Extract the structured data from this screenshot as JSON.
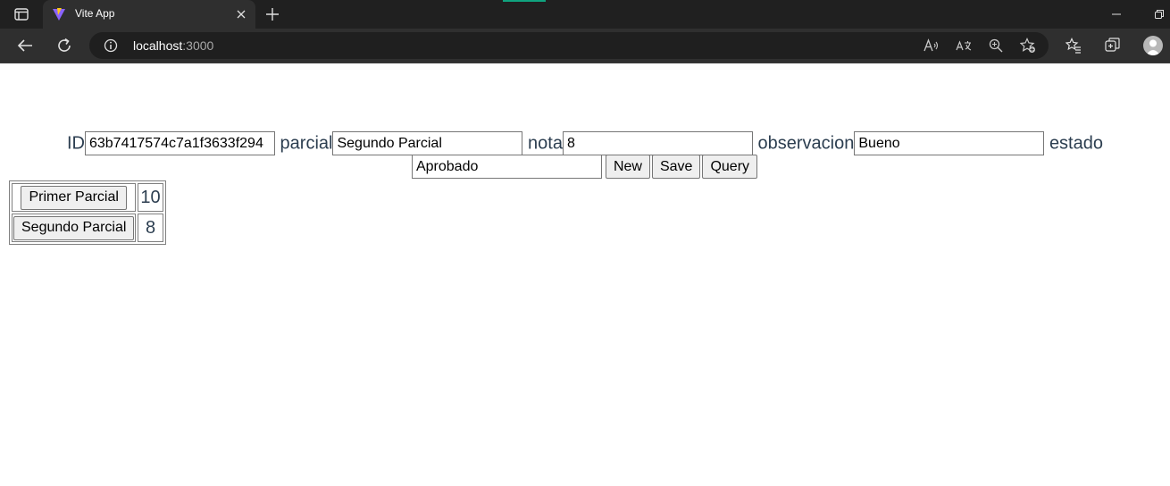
{
  "browser": {
    "tab_title": "Vite App",
    "url_host": "localhost",
    "url_port": ":3000",
    "icons": [
      "tab-actions-icon",
      "vite-favicon-icon",
      "close-icon",
      "plus-icon",
      "minimize-icon",
      "restore-icon",
      "back-arrow-icon",
      "refresh-icon",
      "info-icon",
      "read-aloud-icon",
      "translate-icon",
      "zoom-icon",
      "add-favorite-icon",
      "favorites-icon",
      "collections-icon",
      "profile-avatar-icon"
    ]
  },
  "form": {
    "id_label": "ID",
    "id_value": "63b7417574c7a1f3633f294",
    "parcial_label": "parcial",
    "parcial_value": "Segundo Parcial",
    "nota_label": "nota",
    "nota_value": "8",
    "observacion_label": "observacion",
    "observacion_value": "Bueno",
    "estado_label": "estado",
    "estado_value": "Aprobado",
    "new_label": "New",
    "save_label": "Save",
    "query_label": "Query"
  },
  "table": {
    "rows": [
      {
        "parcial": "Primer Parcial",
        "nota": "10"
      },
      {
        "parcial": "Segundo Parcial",
        "nota": "8"
      }
    ]
  },
  "colors": {
    "text": "#2c3e50",
    "chrome_dark": "#202020",
    "chrome_toolbar": "#2f2f2f"
  }
}
